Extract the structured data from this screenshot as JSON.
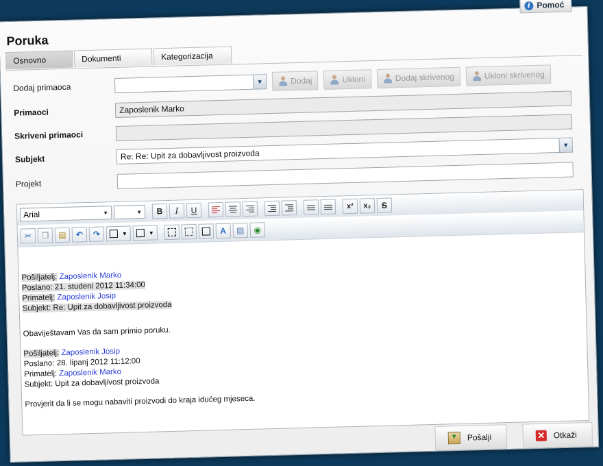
{
  "app": {
    "help_label": "Pomoć",
    "title": "Poruka"
  },
  "tabs": [
    {
      "label": "Osnovno",
      "active": true
    },
    {
      "label": "Dokumenti",
      "active": false
    },
    {
      "label": "Kategorizacija",
      "active": false
    }
  ],
  "form": {
    "add_recipient": {
      "label": "Dodaj primaoca",
      "value": ""
    },
    "buttons": {
      "add": "Dodaj",
      "remove": "Ukloni",
      "add_hidden": "Dodaj skrivenog",
      "remove_hidden": "Ukloni skrivenog"
    },
    "recipients": {
      "label": "Primaoci",
      "value": "Zaposlenik Marko"
    },
    "hidden_recipients": {
      "label": "Skriveni primaoci",
      "value": ""
    },
    "subject": {
      "label": "Subjekt",
      "value": "Re: Re: Upit za dobavljivost proizvoda"
    },
    "project": {
      "label": "Projekt",
      "value": ""
    }
  },
  "editor": {
    "font_name": "Arial",
    "font_size": "",
    "colors": {
      "text_highlight": "#e0e0e0",
      "link": "#2a3fd6"
    },
    "body": {
      "block1": {
        "sender_label": "Pošiljatelj:",
        "sender_value": "Zaposlenik Marko",
        "sent_line": "Poslano: 21. studeni 2012 11:34:00",
        "recipient_label": "Primatelj:",
        "recipient_value": "Zaposlenik Josip",
        "subject_line": "Subjekt: Re: Upit za dobavljivost proizvoda"
      },
      "reply_text": "Obaviještavam Vas da sam primio poruku.",
      "block2": {
        "sender_label": "Pošiljatelj:",
        "sender_value": "Zaposlenik Josip",
        "sent_line": "Poslano: 28. lipanj 2012 11:12:00",
        "recipient_label": "Primatelj:",
        "recipient_value": "Zaposlenik Marko",
        "subject_line": "Subjekt: Upit za dobavljivost proizvoda"
      },
      "original_text": "Provjerit da li se mogu nabaviti proizvodi do kraja idućeg mjeseca."
    }
  },
  "footer": {
    "send_label": "Pošalji",
    "cancel_label": "Otkaži"
  }
}
